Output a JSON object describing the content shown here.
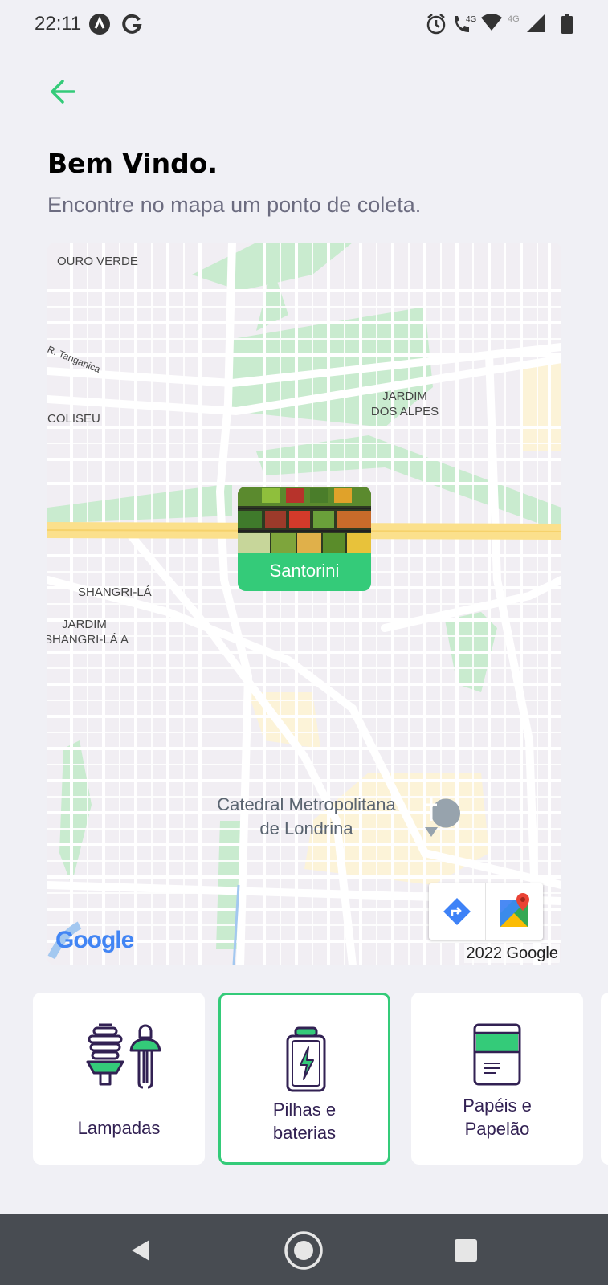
{
  "status_bar": {
    "time": "22:11",
    "left_icons": [
      "app-notification-icon",
      "google-icon"
    ],
    "right_icons": [
      "alarm-icon",
      "volte-call-icon",
      "wifi-icon",
      "signal-4g-icon",
      "battery-icon"
    ],
    "network_label": "4G",
    "call_label": "4G"
  },
  "header": {
    "back_icon": "arrow-left-icon",
    "title": "Bem Vindo.",
    "subtitle": "Encontre no mapa um ponto de coleta."
  },
  "map": {
    "labels": {
      "ouro_verde": "OURO VERDE",
      "tanganica": "R. Tanganica",
      "coliseu": "COLISEU",
      "jardim_dos_alpes_1": "JARDIM",
      "jardim_dos_alpes_2": "DOS ALPES",
      "shangri_la": "SHANGRI-LÁ",
      "jardim_shangri_1": "JARDIM",
      "jardim_shangri_2": "SHANGRI-LÁ A",
      "catedral_1": "Catedral Metropolitana",
      "catedral_2": "de Londrina"
    },
    "marker": {
      "name": "Santorini",
      "image_icon": "produce-shelf-image"
    },
    "tools": [
      "directions-icon",
      "google-maps-icon"
    ],
    "logo": "Google",
    "copyright": "2022 Google",
    "colors": {
      "park": "#c9ebcf",
      "road": "#ffffff",
      "highway": "#fbe08c",
      "accent": "#34cb79"
    }
  },
  "items": [
    {
      "label_1": "Lampadas",
      "label_2": "",
      "icon": "lamps-icon",
      "selected": false
    },
    {
      "label_1": "Pilhas e",
      "label_2": "baterias",
      "icon": "battery-icon",
      "selected": true
    },
    {
      "label_1": "Papéis e",
      "label_2": "Papelão",
      "icon": "paper-icon",
      "selected": false
    }
  ],
  "nav": [
    "back-nav-icon",
    "home-nav-icon",
    "recents-nav-icon"
  ]
}
